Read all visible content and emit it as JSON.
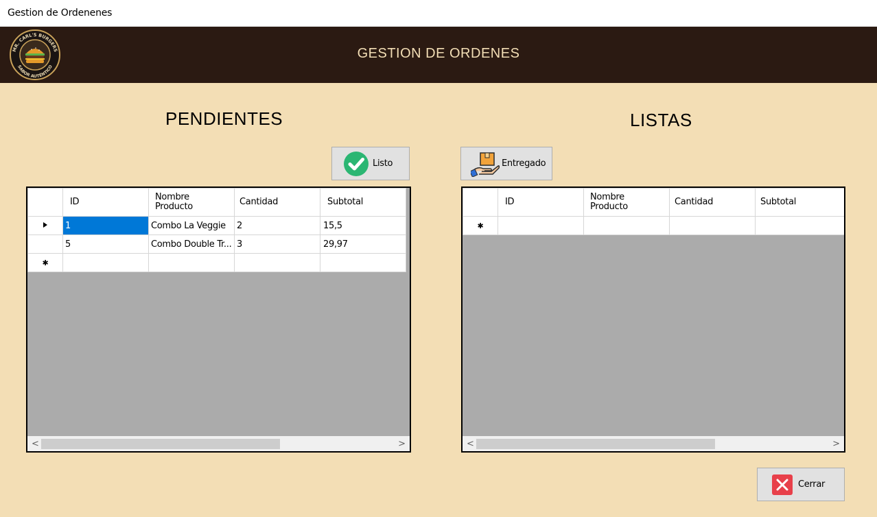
{
  "window": {
    "title": "Gestion de Ordenenes"
  },
  "header": {
    "title": "GESTION DE ORDENES",
    "logo": {
      "top_text": "MR. CARL'S BURGERS",
      "bottom_text": "SABOR AUTÉNTICO"
    }
  },
  "pendientes": {
    "title": "PENDIENTES",
    "button_label": "Listo",
    "columns": [
      "ID",
      "Nombre\nProducto",
      "Cantidad",
      "Subtotal"
    ],
    "rows": [
      {
        "id": "1",
        "nombre": "Combo La Veggie",
        "cantidad": "2",
        "subtotal": "15,5"
      },
      {
        "id": "5",
        "nombre": "Combo Double Tr...",
        "cantidad": "3",
        "subtotal": "29,97"
      }
    ]
  },
  "listas": {
    "title": "LISTAS",
    "button_label": "Entregado",
    "columns": [
      "ID",
      "Nombre\nProducto",
      "Cantidad",
      "Subtotal"
    ],
    "rows": []
  },
  "footer": {
    "close_label": "Cerrar"
  },
  "colors": {
    "background": "#f3deb5",
    "header": "#2b1a12",
    "selection": "#0078d7",
    "close_red": "#e8404a",
    "check_green": "#2bb673"
  }
}
